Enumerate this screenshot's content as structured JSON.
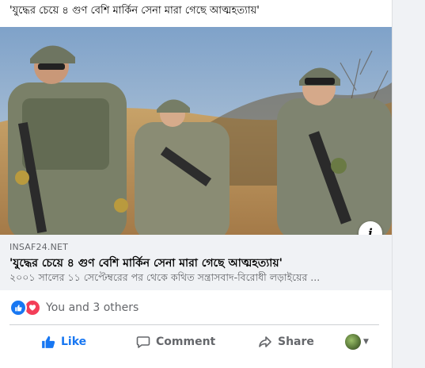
{
  "post": {
    "caption": "'যুদ্ধের চেয়ে ৪ গুণ বেশি মার্কিন সেনা মারা গেছে আত্মহত্যায়'"
  },
  "link": {
    "domain": "INSAF24.NET",
    "title": "'যুদ্ধের চেয়ে ৪ গুণ বেশি মার্কিন সেনা মারা গেছে আত্মহত্যায়'",
    "description": "২০০১ সালের ১১ সেপ্টেম্বরের পর থেকে কথিত সন্ত্রাসবাদ-বিরোধী লড়াইয়ের ...",
    "info_glyph": "i",
    "image_subject": "soldiers-photo"
  },
  "reactions": {
    "types": [
      "like-icon",
      "love-icon"
    ],
    "summary": "You and 3 others"
  },
  "actions": {
    "like_label": "Like",
    "comment_label": "Comment",
    "share_label": "Share"
  },
  "colors": {
    "accent": "#1877f2",
    "love": "#f33e58",
    "muted": "#65676b",
    "link_bg": "#f0f2f5"
  }
}
